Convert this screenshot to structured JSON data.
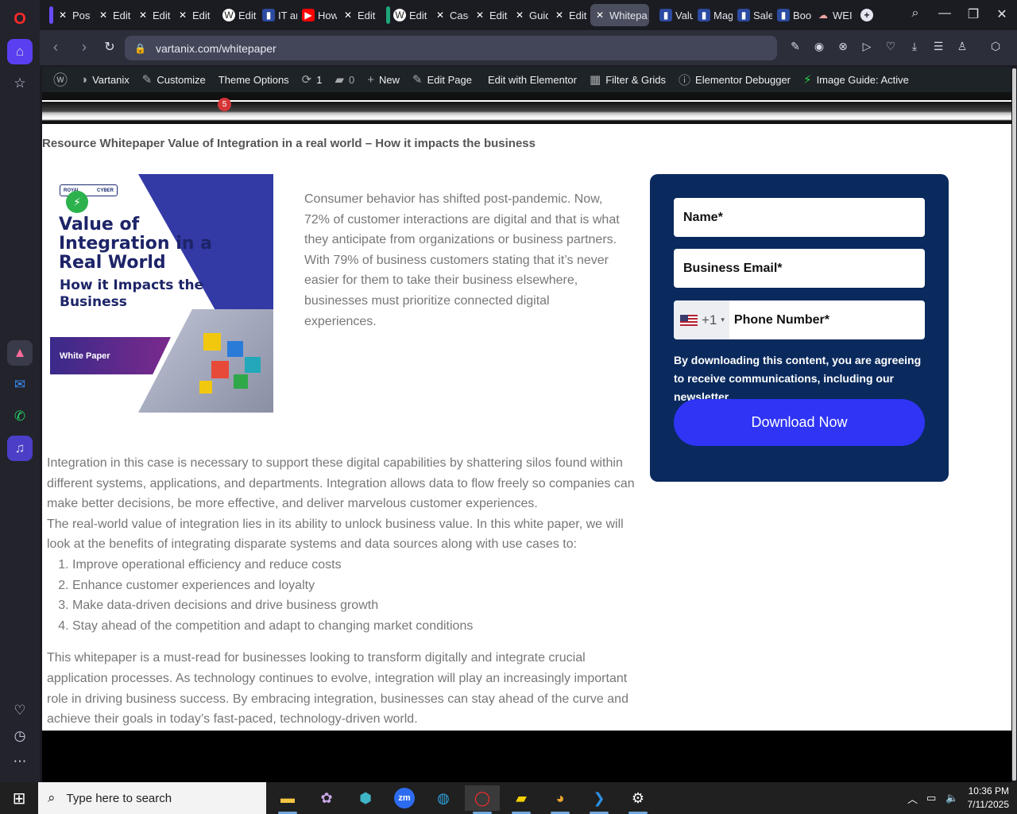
{
  "browser": {
    "tabs": [
      {
        "label": "Post",
        "icon": "x-icon"
      },
      {
        "label": "Edit",
        "icon": "x-icon"
      },
      {
        "label": "Edit",
        "icon": "x-icon"
      },
      {
        "label": "Edit",
        "icon": "x-icon"
      },
      {
        "label": "Edit",
        "icon": "wp-icon"
      },
      {
        "label": "IT ar",
        "icon": "doc-icon"
      },
      {
        "label": "How",
        "icon": "youtube-icon"
      },
      {
        "label": "Edit",
        "icon": "x-icon"
      },
      {
        "label": "Edit",
        "icon": "wp-icon"
      },
      {
        "label": "Case",
        "icon": "x-icon"
      },
      {
        "label": "Edit",
        "icon": "x-icon"
      },
      {
        "label": "Guid",
        "icon": "x-icon"
      },
      {
        "label": "Edit",
        "icon": "x-icon"
      },
      {
        "label": "Whitepa",
        "icon": "x-icon"
      },
      {
        "label": "Valu",
        "icon": "doc-icon"
      },
      {
        "label": "Mag",
        "icon": "doc-icon"
      },
      {
        "label": "Sale",
        "icon": "doc-icon"
      },
      {
        "label": "Boo",
        "icon": "doc-icon"
      },
      {
        "label": "WEI",
        "icon": "cloud-icon"
      }
    ],
    "url": "vartanix.com/whitepaper"
  },
  "wp_admin_bar": {
    "site": "Vartanix",
    "customize": "Customize",
    "theme_options": "Theme Options",
    "updates_count": "1",
    "comments_count": "0",
    "new": "New",
    "edit_page": "Edit Page",
    "edit_elementor": "Edit with Elementor",
    "filter_grids": "Filter & Grids",
    "elementor_debugger": "Elementor Debugger",
    "image_guide": "Image Guide: Active"
  },
  "subheader": {
    "badge": "5"
  },
  "page": {
    "breadcrumb": "Resource Whitepaper Value of Integration in a real world – How it impacts the business",
    "cover": {
      "logo_left": "ROYAL",
      "logo_right": "CYBER",
      "title": "Value of Integration in a Real World",
      "subtitle": "How it Impacts the Business",
      "band": "White Paper"
    },
    "intro_p1": "Consumer behavior has shifted post-pandemic. Now, 72% of customer interactions are digital and that is what they anticipate from organizations or business partners.",
    "intro_p2": "With 79% of business customers stating that it’s never easier for them to take their business elsewhere, businesses must prioritize connected digital experiences.",
    "body_p1": "Integration in this case is necessary to support these digital capabilities by shattering silos found within different systems, applications, and departments. Integration allows data to flow freely so companies can make better decisions, be more effective, and deliver marvelous customer experiences.",
    "body_p2": "The real-world value of integration lies in its ability to unlock business value. In this white paper, we will look at the benefits of integrating disparate systems and data sources along with use cases to:",
    "list": [
      "Improve operational efficiency and reduce costs",
      "Enhance customer experiences and loyalty",
      "Make data-driven decisions and drive business growth",
      "Stay ahead of the competition and adapt to changing market conditions"
    ],
    "body_p3": "This whitepaper is a must-read for businesses looking to transform digitally and integrate crucial application processes. As technology continues to evolve, integration will play an increasingly important role in driving business success. By embracing integration, businesses can stay ahead of the curve and achieve their goals in today’s fast-paced, technology-driven world."
  },
  "form": {
    "name_placeholder": "Name*",
    "email_placeholder": "Business Email*",
    "phone_code": "+1",
    "phone_placeholder": "Phone Number*",
    "consent": "By downloading this content, you are agreeing to receive communications, including our newsletter.",
    "submit": "Download Now"
  },
  "taskbar": {
    "search_placeholder": "Type here to search",
    "time": "10:36 PM",
    "date": "7/11/2025"
  },
  "colors": {
    "form_bg": "#0a2a5e",
    "button": "#2f34f5",
    "wp_bar": "#1d2327"
  }
}
